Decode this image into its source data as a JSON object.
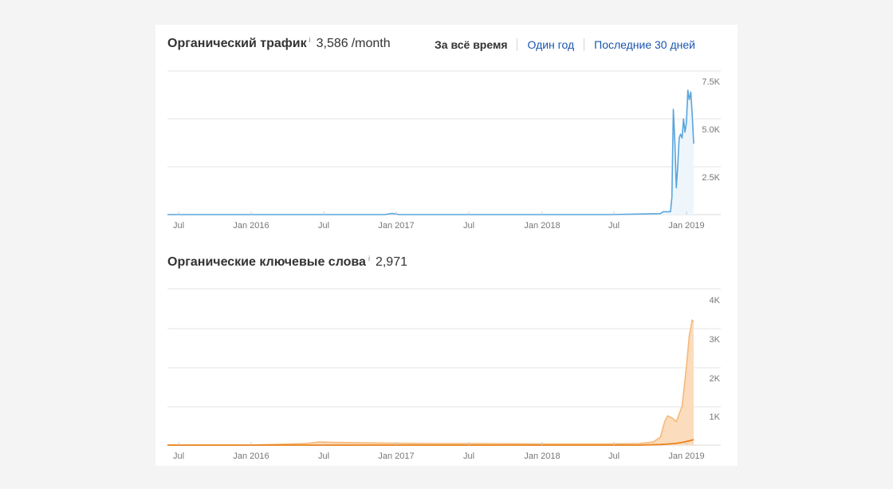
{
  "traffic": {
    "title": "Органический трафик",
    "info": "i",
    "value": "3,586",
    "unit": "/month",
    "ranges": [
      {
        "label": "За всё время",
        "active": true
      },
      {
        "label": "Один год",
        "active": false
      },
      {
        "label": "Последние 30 дней",
        "active": false
      }
    ]
  },
  "keywords": {
    "title": "Органические ключевые слова",
    "info": "i",
    "value": "2,971"
  },
  "colors": {
    "traffic_line": "#5aa5dc",
    "traffic_fill": "#eef6fc",
    "keywords_line": "#f5b97a",
    "keywords_fill": "#fbdcbd",
    "keywords_top": "#e8821e",
    "grid": "#e6e6e6"
  },
  "chart_data": [
    {
      "type": "area",
      "x_tick_labels": [
        "Jul",
        "Jan 2016",
        "Jul",
        "Jan 2017",
        "Jul",
        "Jan 2018",
        "Jul",
        "Jan 2019"
      ],
      "y_tick_labels": [
        "7.5K",
        "5.0K",
        "2.5K"
      ],
      "ylim": [
        0,
        7500
      ],
      "xlim": [
        2015.45,
        2019.08
      ],
      "series": [
        {
          "x": [
            2015.45,
            2016.0,
            2016.5,
            2016.95,
            2017.0,
            2017.05,
            2017.5,
            2018.0,
            2018.5,
            2018.85,
            2018.87,
            2018.88,
            2018.92,
            2018.93,
            2018.94,
            2018.95,
            2018.96,
            2018.97,
            2018.98,
            2018.99,
            2019.0,
            2019.01,
            2019.02,
            2019.03,
            2019.04,
            2019.05,
            2019.06,
            2019.07,
            2019.08
          ],
          "values": [
            0,
            0,
            0,
            0,
            60,
            0,
            0,
            0,
            0,
            50,
            150,
            150,
            150,
            900,
            5500,
            3800,
            1400,
            2500,
            4000,
            4200,
            4000,
            5000,
            4300,
            4800,
            6500,
            6000,
            6400,
            5200,
            3700
          ]
        }
      ]
    },
    {
      "type": "area",
      "x_tick_labels": [
        "Jul",
        "Jan 2016",
        "Jul",
        "Jan 2017",
        "Jul",
        "Jan 2018",
        "Jul",
        "Jan 2019"
      ],
      "y_tick_labels": [
        "4K",
        "3K",
        "2K",
        "1K"
      ],
      "ylim": [
        0,
        4000
      ],
      "xlim": [
        2015.45,
        2019.08
      ],
      "series": [
        {
          "x": [
            2015.45,
            2016.0,
            2016.4,
            2016.5,
            2016.6,
            2016.8,
            2017.0,
            2017.3,
            2017.6,
            2018.0,
            2018.5,
            2018.7,
            2018.8,
            2018.85,
            2018.88,
            2018.9,
            2018.93,
            2018.96,
            2019.0,
            2019.03,
            2019.05,
            2019.07,
            2019.08
          ],
          "values": [
            0,
            0,
            40,
            80,
            70,
            60,
            50,
            40,
            40,
            30,
            30,
            40,
            80,
            200,
            600,
            750,
            700,
            600,
            1000,
            2000,
            2800,
            3200,
            3150
          ]
        },
        {
          "x": [
            2015.45,
            2016.0,
            2017.0,
            2018.0,
            2018.7,
            2018.85,
            2018.95,
            2019.0,
            2019.05,
            2019.08
          ],
          "values": [
            0,
            0,
            0,
            0,
            0,
            15,
            40,
            70,
            110,
            140
          ]
        }
      ]
    }
  ]
}
